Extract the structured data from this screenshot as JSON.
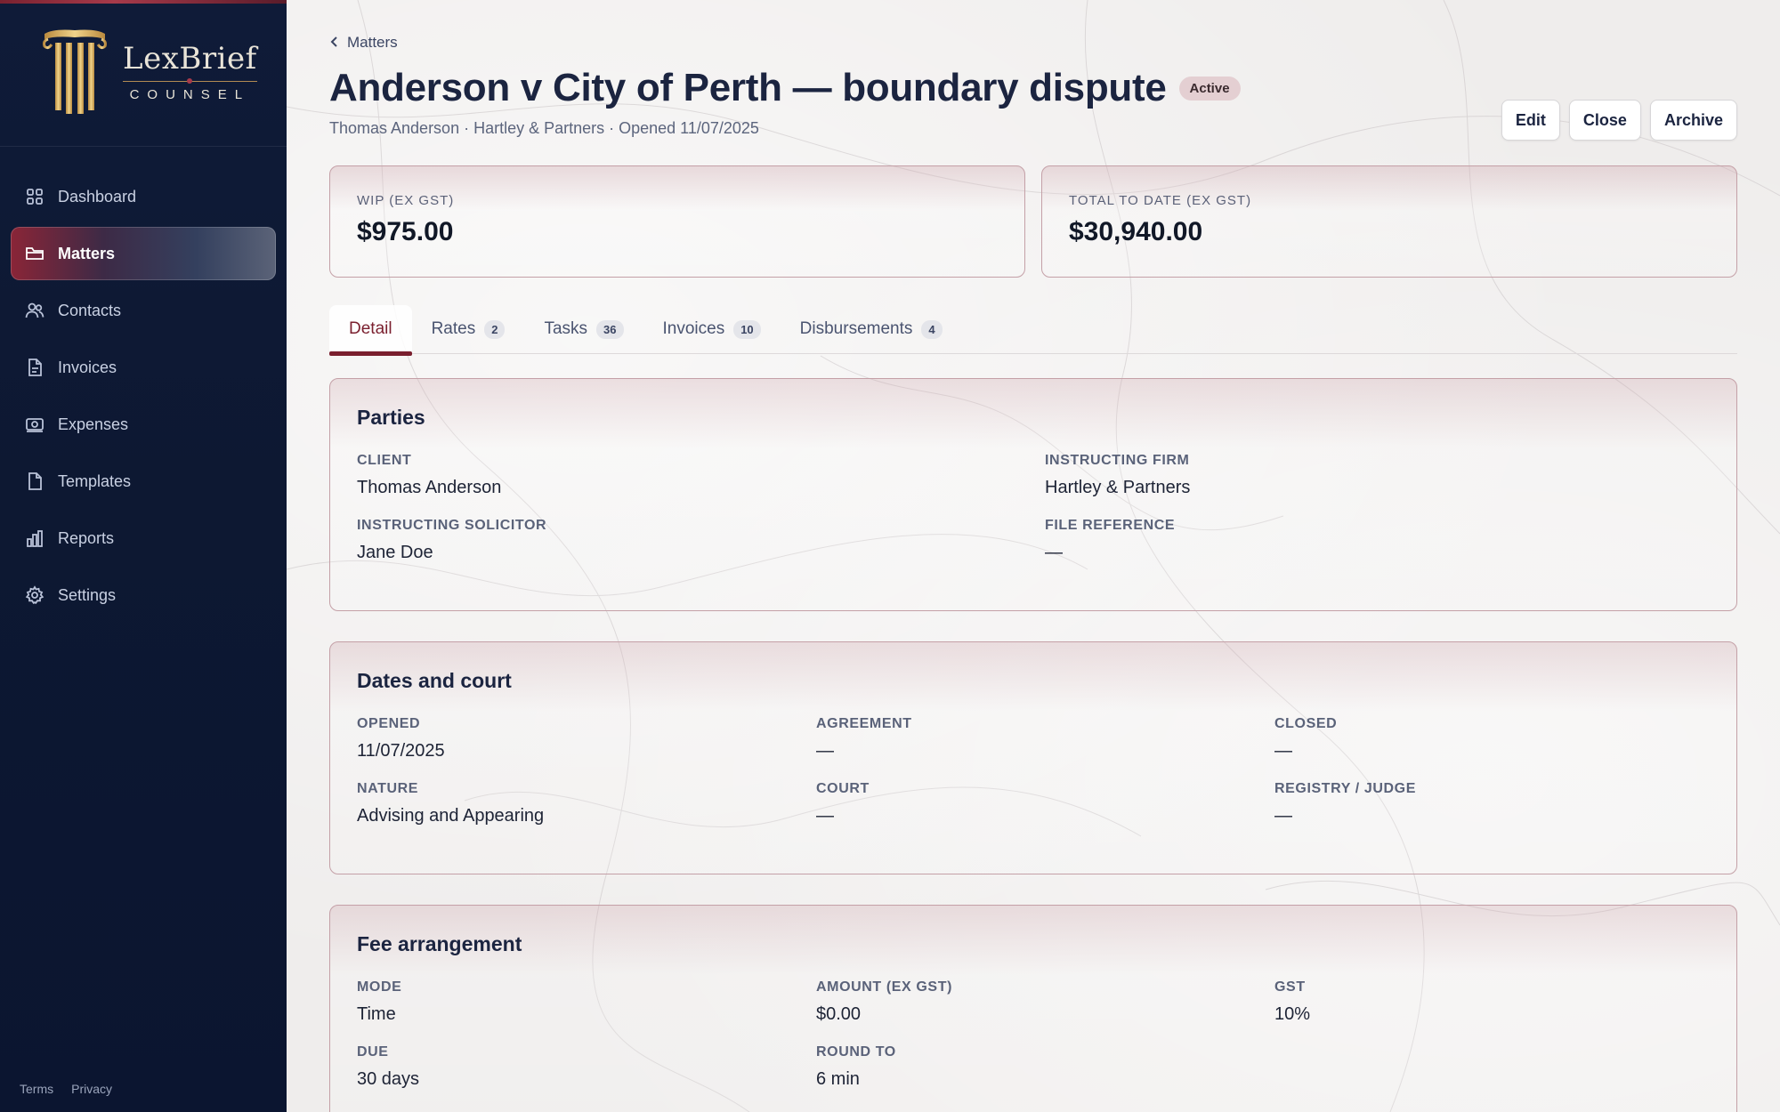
{
  "brand": {
    "name": "LexBrief",
    "sub": "COUNSEL"
  },
  "sidebar": {
    "items": [
      {
        "label": "Dashboard",
        "icon": "dashboard-icon"
      },
      {
        "label": "Matters",
        "icon": "folder-icon",
        "active": true
      },
      {
        "label": "Contacts",
        "icon": "users-icon"
      },
      {
        "label": "Invoices",
        "icon": "invoice-icon"
      },
      {
        "label": "Expenses",
        "icon": "expenses-icon"
      },
      {
        "label": "Templates",
        "icon": "template-icon"
      },
      {
        "label": "Reports",
        "icon": "bar-chart-icon"
      },
      {
        "label": "Settings",
        "icon": "gear-icon"
      }
    ],
    "footer": {
      "terms": "Terms",
      "privacy": "Privacy"
    }
  },
  "header": {
    "breadcrumb": "Matters",
    "title": "Anderson v City of Perth — boundary dispute",
    "status": "Active",
    "subtitle": "Thomas Anderson · Hartley & Partners · Opened 11/07/2025",
    "actions": {
      "edit": "Edit",
      "close": "Close",
      "archive": "Archive"
    }
  },
  "stats": {
    "wip": {
      "label": "WIP (EX GST)",
      "value": "$975.00"
    },
    "total": {
      "label": "TOTAL TO DATE (EX GST)",
      "value": "$30,940.00"
    }
  },
  "tabs": [
    {
      "label": "Detail",
      "count": null,
      "active": true
    },
    {
      "label": "Rates",
      "count": "2"
    },
    {
      "label": "Tasks",
      "count": "36"
    },
    {
      "label": "Invoices",
      "count": "10"
    },
    {
      "label": "Disbursements",
      "count": "4"
    }
  ],
  "parties": {
    "title": "Parties",
    "client_label": "CLIENT",
    "client": "Thomas Anderson",
    "firm_label": "INSTRUCTING FIRM",
    "firm": "Hartley & Partners",
    "solicitor_label": "INSTRUCTING SOLICITOR",
    "solicitor": "Jane Doe",
    "fileref_label": "FILE REFERENCE",
    "fileref": "—"
  },
  "dates": {
    "title": "Dates and court",
    "opened_label": "OPENED",
    "opened": "11/07/2025",
    "agreement_label": "AGREEMENT",
    "agreement": "—",
    "closed_label": "CLOSED",
    "closed": "—",
    "nature_label": "NATURE",
    "nature": "Advising and Appearing",
    "court_label": "COURT",
    "court": "—",
    "registry_label": "REGISTRY / JUDGE",
    "registry": "—"
  },
  "fees": {
    "title": "Fee arrangement",
    "mode_label": "MODE",
    "mode": "Time",
    "amount_label": "AMOUNT (EX GST)",
    "amount": "$0.00",
    "gst_label": "GST",
    "gst": "10%",
    "due_label": "DUE",
    "due": "30 days",
    "round_label": "ROUND TO",
    "round": "6 min"
  },
  "colors": {
    "navy": "#0f1b38",
    "accent": "#7a1f2e",
    "gold": "#c9a45a"
  }
}
